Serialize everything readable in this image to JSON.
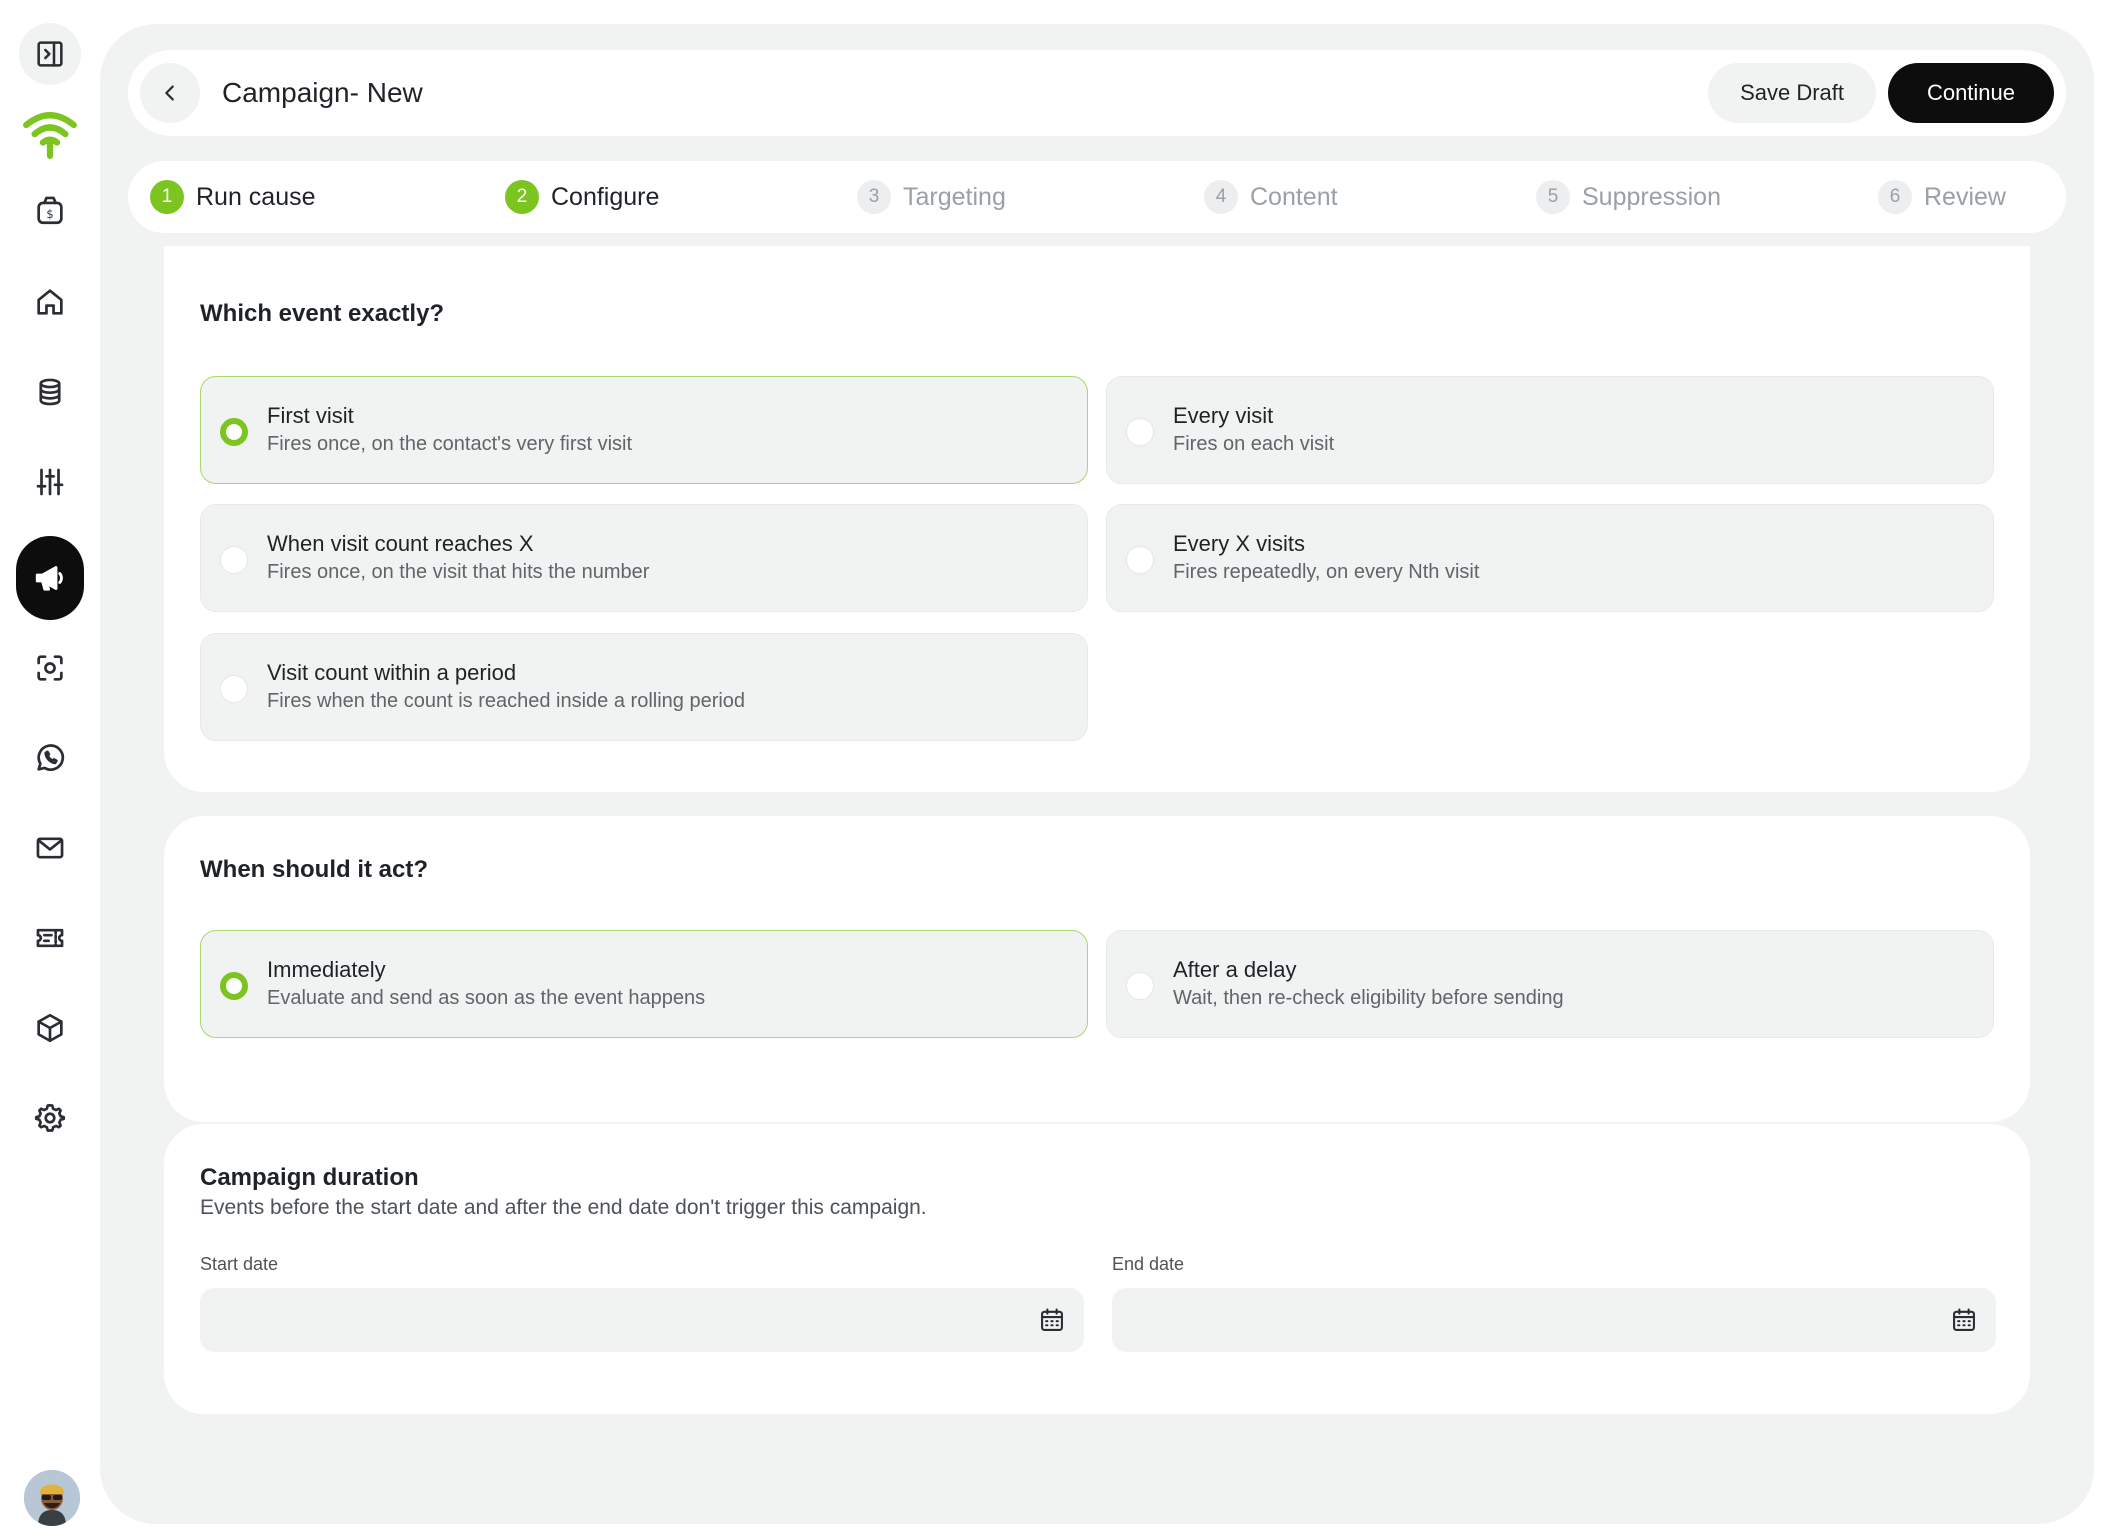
{
  "header": {
    "title": "Campaign- New",
    "save_draft_label": "Save Draft",
    "continue_label": "Continue"
  },
  "steps": [
    {
      "num": "1",
      "label": "Run cause",
      "state": "done"
    },
    {
      "num": "2",
      "label": "Configure",
      "state": "done"
    },
    {
      "num": "3",
      "label": "Targeting",
      "state": "todo"
    },
    {
      "num": "4",
      "label": "Content",
      "state": "todo"
    },
    {
      "num": "5",
      "label": "Suppression",
      "state": "todo"
    },
    {
      "num": "6",
      "label": "Review",
      "state": "todo"
    }
  ],
  "event_section": {
    "title": "Which event exactly?",
    "options": [
      {
        "title": "First visit",
        "desc": "Fires once, on the contact's very first visit",
        "selected": true
      },
      {
        "title": "Every visit",
        "desc": "Fires on each visit",
        "selected": false
      },
      {
        "title": "When visit count reaches X",
        "desc": "Fires once, on the visit that hits the number",
        "selected": false
      },
      {
        "title": "Every X visits",
        "desc": "Fires repeatedly, on every Nth visit",
        "selected": false
      },
      {
        "title": "Visit count within a period",
        "desc": "Fires when the count is reached inside a rolling period",
        "selected": false
      }
    ]
  },
  "timing_section": {
    "title": "When should it act?",
    "options": [
      {
        "title": "Immediately",
        "desc": "Evaluate and send as soon as the event happens",
        "selected": true
      },
      {
        "title": "After a delay",
        "desc": "Wait, then re-check eligibility before sending",
        "selected": false
      }
    ]
  },
  "duration_section": {
    "title": "Campaign duration",
    "desc": "Events before the start date and after the end date don't trigger this campaign.",
    "start_label": "Start date",
    "start_value": "",
    "end_label": "End date",
    "end_value": ""
  },
  "sidebar": {
    "items": [
      "sidebar-toggle-icon",
      "brand-logo",
      "wallet-icon",
      "home-icon",
      "database-icon",
      "sliders-icon",
      "megaphone-icon",
      "scan-icon",
      "whatsapp-icon",
      "mail-icon",
      "ticket-icon",
      "box-icon",
      "settings-icon"
    ],
    "active": "megaphone-icon"
  },
  "colors": {
    "accent": "#7cc41f",
    "surface": "#f1f2f2",
    "dark": "#0d0d0d"
  }
}
